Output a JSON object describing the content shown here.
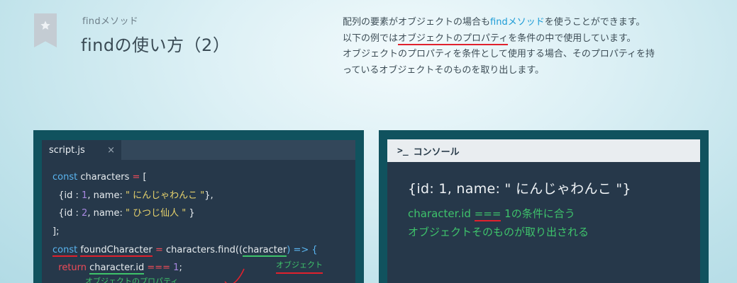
{
  "header": {
    "subtitle": "findメソッド",
    "title": "findの使い方（2）",
    "badge_icon": "star-icon"
  },
  "description": {
    "p1_a": "配列の要素がオブジェクトの場合も",
    "p1_link": "findメソッド",
    "p1_b": "を使うことができます。",
    "p2_a": "以下の例では",
    "p2_ul": "オブジェクトのプロパティ",
    "p2_b": "を条件の中で使用しています。",
    "p3": "オブジェクトのプロパティを条件として使用する場合、そのプロパティを持",
    "p4": "っているオブジェクトそのものを取り出します。"
  },
  "editor": {
    "tab_label": "script.js",
    "tab_close": "×",
    "lines": {
      "l1_kw": "const",
      "l1_name": " characters ",
      "l1_op": "=",
      "l1_rest": " [",
      "l2_a": "  {id : ",
      "l2_num": "1",
      "l2_b": ", name: ",
      "l2_str": "\" にんじゃわんこ \"",
      "l2_c": "},",
      "l3_a": "  {id : ",
      "l3_num": "2",
      "l3_b": ", name: ",
      "l3_str": "\" ひつじ仙人 \"",
      "l3_c": " }",
      "l4": "];",
      "l5_kw": "const",
      "l5_sp": " ",
      "l5_name": "foundCharacter",
      "l5_op": " = ",
      "l5_call": "characters.find((",
      "l5_param": "character",
      "l5_arrow": ") => {",
      "l6_kw": "  return",
      "l6_sp": " ",
      "l6_expr": "character.id",
      "l6_op": " === ",
      "l6_num": "1",
      "l6_end": ";"
    },
    "annotation_object": "オブジェクト",
    "annotation_property": "オブジェクトのプロパティ"
  },
  "console": {
    "prompt": ">_",
    "title": "コンソール",
    "output": "{id: 1, name: \" にんじゃわんこ \"}",
    "note1_a": "character.id ",
    "note1_op": "===",
    "note1_b": " 1の条件に合う",
    "note2": "オブジェクトそのものが取り出される"
  },
  "colors": {
    "accent_link": "#1c9bd6",
    "underline_red": "#e0212d",
    "annotation_green": "#3ec36b",
    "panel_frame": "#10525e",
    "panel_bg": "#26384a"
  }
}
